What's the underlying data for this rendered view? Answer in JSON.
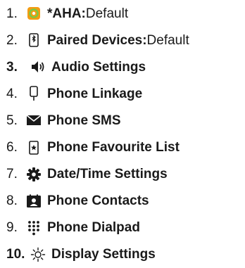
{
  "menu": {
    "items": [
      {
        "number": "1.",
        "label": "*AHA:",
        "value": " Default",
        "icon": "aha-icon"
      },
      {
        "number": "2.",
        "label": "Paired Devices:",
        "value": " Default",
        "icon": "bluetooth-icon"
      },
      {
        "number": "3.",
        "label": "Audio Settings",
        "value": "",
        "icon": "speaker-icon"
      },
      {
        "number": "4.",
        "label": "Phone Linkage",
        "value": "",
        "icon": "phone-linkage-icon"
      },
      {
        "number": "5.",
        "label": "Phone SMS",
        "value": "",
        "icon": "envelope-icon"
      },
      {
        "number": "6.",
        "label": "Phone Favourite List",
        "value": "",
        "icon": "favourite-list-icon"
      },
      {
        "number": "7.",
        "label": "Date/Time Settings",
        "value": "",
        "icon": "gear-icon"
      },
      {
        "number": "8.",
        "label": "Phone Contacts",
        "value": "",
        "icon": "contacts-icon"
      },
      {
        "number": "9.",
        "label": "Phone Dialpad",
        "value": "",
        "icon": "dialpad-icon"
      },
      {
        "number": "10.",
        "label": "Display Settings",
        "value": "",
        "icon": "brightness-icon"
      }
    ],
    "active_index": 3
  },
  "colors": {
    "aha_orange": "#f39c12",
    "aha_green": "#7ac943",
    "text": "#1a1a1a"
  }
}
